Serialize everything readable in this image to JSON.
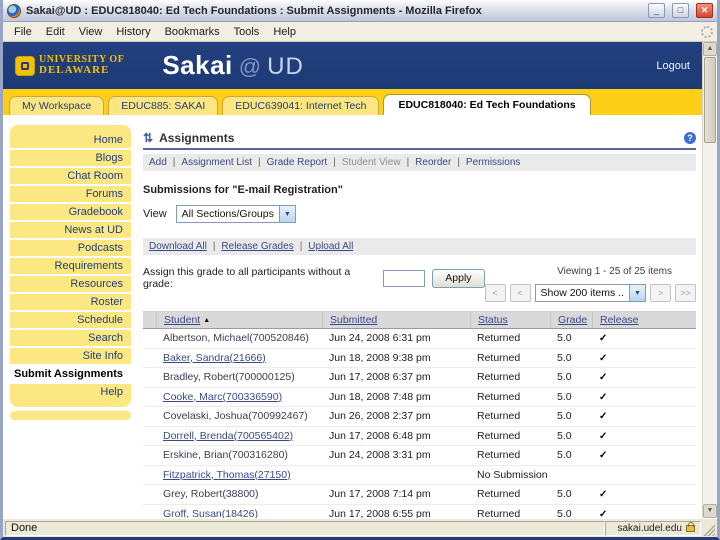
{
  "window": {
    "title": "Sakai@UD : EDUC818040: Ed Tech Foundations : Submit Assignments - Mozilla Firefox",
    "menu_items": [
      "File",
      "Edit",
      "View",
      "History",
      "Bookmarks",
      "Tools",
      "Help"
    ],
    "status_left": "Done",
    "status_right": "sakai.udel.edu"
  },
  "header": {
    "logo_line1": "UNIVERSITY OF",
    "logo_line2": "DELAWARE",
    "brand_sakai": "Sakai",
    "brand_at": "@",
    "brand_ud": "UD",
    "logout": "Logout"
  },
  "tabs": [
    {
      "label": "My Workspace",
      "active": false
    },
    {
      "label": "EDUC885: SAKAI",
      "active": false
    },
    {
      "label": "EDUC639041: Internet Tech",
      "active": false
    },
    {
      "label": "EDUC818040: Ed Tech Foundations",
      "active": true
    }
  ],
  "sidebar": {
    "items": [
      "Home",
      "Blogs",
      "Chat Room",
      "Forums",
      "Gradebook",
      "News at UD",
      "Podcasts",
      "Requirements",
      "Resources",
      "Roster",
      "Schedule",
      "Search",
      "Site Info",
      "Submit Assignments",
      "Help"
    ],
    "active": "Submit Assignments"
  },
  "portlet": {
    "title": "Assignments",
    "actions": [
      {
        "label": "Add",
        "enabled": true
      },
      {
        "label": "Assignment List",
        "enabled": true
      },
      {
        "label": "Grade Report",
        "enabled": true
      },
      {
        "label": "Student View",
        "enabled": false
      },
      {
        "label": "Reorder",
        "enabled": true
      },
      {
        "label": "Permissions",
        "enabled": true
      }
    ],
    "submissions_heading": "Submissions for \"E-mail Registration\"",
    "view_label": "View",
    "view_value": "All Sections/Groups",
    "bulk_links": [
      "Download All",
      "Release Grades",
      "Upload All"
    ],
    "assign_text": "Assign this grade to all participants without a grade:",
    "grade_input_value": "",
    "apply_label": "Apply",
    "viewing_text": "Viewing 1 - 25 of 25 items",
    "page_size_value": "Show 200 items ..",
    "pager": {
      "first": "<",
      "prev": "<",
      "next": ">",
      "last": ">>"
    }
  },
  "table": {
    "headers": [
      "Student",
      "Submitted",
      "Status",
      "Grade",
      "Release"
    ],
    "sort_indicator": "▲",
    "check_glyph": "✓",
    "rows": [
      {
        "name": "Albertson, Michael(700520846)",
        "link": false,
        "submitted": "Jun 24, 2008 6:31 pm",
        "status": "Returned",
        "grade": "5.0",
        "released": true
      },
      {
        "name": "Baker, Sandra(21666)",
        "link": true,
        "submitted": "Jun 18, 2008 9:38 pm",
        "status": "Returned",
        "grade": "5.0",
        "released": true
      },
      {
        "name": "Bradley, Robert(700000125)",
        "link": false,
        "submitted": "Jun 17, 2008 6:37 pm",
        "status": "Returned",
        "grade": "5.0",
        "released": true
      },
      {
        "name": "Cooke, Marc(700336590)",
        "link": true,
        "submitted": "Jun 18, 2008 7:48 pm",
        "status": "Returned",
        "grade": "5.0",
        "released": true
      },
      {
        "name": "Covelaski, Joshua(700992467)",
        "link": false,
        "submitted": "Jun 26, 2008 2:37 pm",
        "status": "Returned",
        "grade": "5.0",
        "released": true
      },
      {
        "name": "Dorrell, Brenda(700565402)",
        "link": true,
        "submitted": "Jun 17, 2008 6:48 pm",
        "status": "Returned",
        "grade": "5.0",
        "released": true
      },
      {
        "name": "Erskine, Brian(700316280)",
        "link": false,
        "submitted": "Jun 24, 2008 3:31 pm",
        "status": "Returned",
        "grade": "5.0",
        "released": true
      },
      {
        "name": "Fitzpatrick, Thomas(27150)",
        "link": true,
        "submitted": "",
        "status": "No Submission",
        "grade": "",
        "released": false
      },
      {
        "name": "Grey, Robert(38800)",
        "link": false,
        "submitted": "Jun 17, 2008 7:14 pm",
        "status": "Returned",
        "grade": "5.0",
        "released": true
      },
      {
        "name": "Groff, Susan(18426)",
        "link": true,
        "submitted": "Jun 17, 2008 6:55 pm",
        "status": "Returned",
        "grade": "5.0",
        "released": true
      }
    ]
  },
  "icons": {
    "assignments_glyph": "⇅",
    "help_glyph": "?",
    "dropdown_glyph": "▼",
    "minimize_glyph": "_",
    "maximize_glyph": "□",
    "close_glyph": "✕",
    "scroll_up_glyph": "▲",
    "scroll_down_glyph": "▼"
  },
  "colors": {
    "navy": "#203d7c",
    "gold": "#fdd017",
    "tab-yellow": "#fbe682",
    "menu-yellow": "#fce883",
    "link": "#3a4a86",
    "bar-gray": "#eaeaea",
    "chrome": "#ece9d8"
  }
}
